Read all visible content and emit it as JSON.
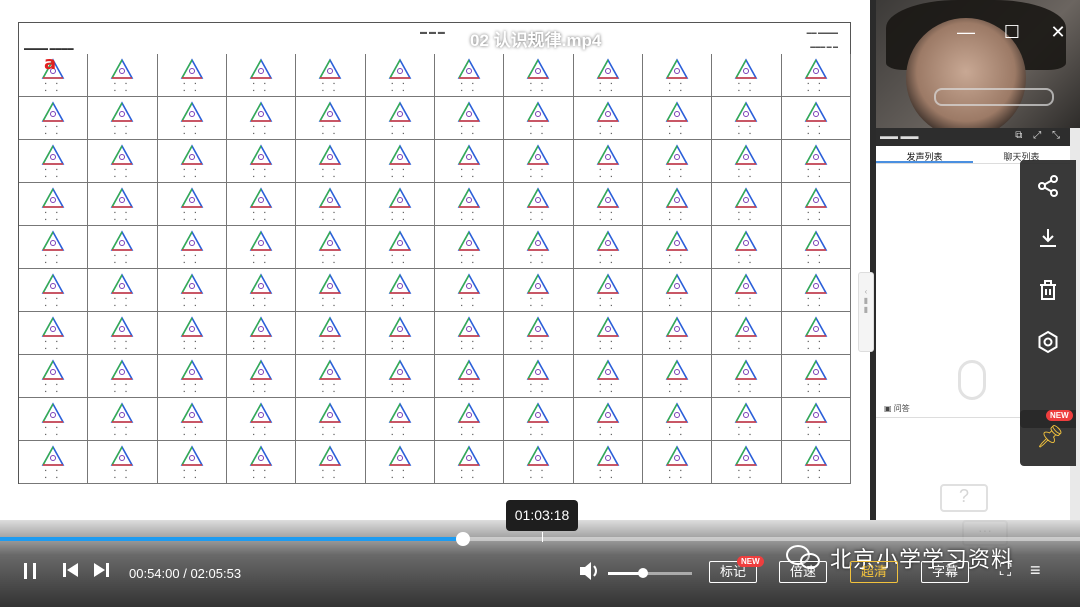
{
  "player": {
    "video_title": "02 认识规律.mp4",
    "current_time": "00:54:00",
    "total_time": "02:05:53",
    "time_separator": " / ",
    "hover_time": "01:03:18",
    "progress": 0.429,
    "volume": 0.42
  },
  "controls": {
    "pause_icon": "pause-icon",
    "prev_icon": "skip-previous-icon",
    "next_icon": "skip-next-icon",
    "volume_icon": "volume-icon",
    "mark_label": "标记",
    "speed_label": "倍速",
    "quality_label": "超清",
    "subtitle_label": "字幕",
    "new_badge": "NEW"
  },
  "watermark": {
    "text": "北京小学学习资料"
  },
  "float_menu": {
    "items": [
      "share-icon",
      "download-icon",
      "delete-icon",
      "settings-icon"
    ],
    "pin_icon": "pin-icon",
    "pin_badge": "NEW"
  },
  "side_panel": {
    "tabs": [
      "发声列表",
      "聊天列表"
    ],
    "chat_label": "问答"
  },
  "doc": {
    "red_mark": "a"
  },
  "colors": {
    "progress": "#1d9bf0",
    "accent": "#f2c23d",
    "badge": "#ee3e3e"
  }
}
